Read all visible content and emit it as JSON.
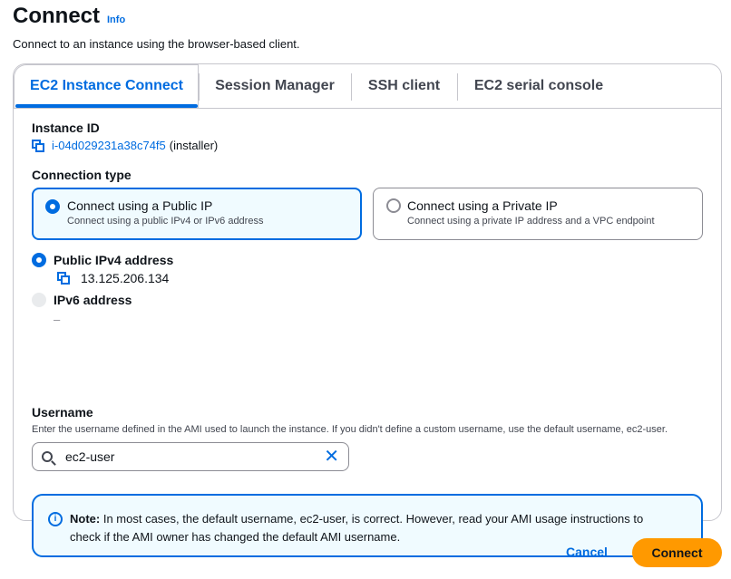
{
  "header": {
    "title": "Connect",
    "info_label": "Info",
    "description": "Connect to an instance using the browser-based client."
  },
  "tabs": [
    {
      "label": "EC2 Instance Connect",
      "active": true
    },
    {
      "label": "Session Manager",
      "active": false
    },
    {
      "label": "SSH client",
      "active": false
    },
    {
      "label": "EC2 serial console",
      "active": false
    }
  ],
  "instance": {
    "label": "Instance ID",
    "id": "i-04d029231a38c74f5",
    "suffix": "(installer)"
  },
  "connection_type": {
    "label": "Connection type",
    "options": [
      {
        "title": "Connect using a Public IP",
        "description": "Connect using a public IPv4 or IPv6 address",
        "selected": true
      },
      {
        "title": "Connect using a Private IP",
        "description": "Connect using a private IP address and a VPC endpoint",
        "selected": false
      }
    ]
  },
  "address": {
    "ipv4_label": "Public IPv4 address",
    "ipv4_value": "13.125.206.134",
    "ipv6_label": "IPv6 address",
    "ipv6_value": "–"
  },
  "username": {
    "label": "Username",
    "help": "Enter the username defined in the AMI used to launch the instance. If you didn't define a custom username, use the default username, ec2-user.",
    "value": "ec2-user"
  },
  "alert": {
    "bold": "Note:",
    "text": " In most cases, the default username, ec2-user, is correct. However, read your AMI usage instructions to check if the AMI owner has changed the default AMI username."
  },
  "footer": {
    "cancel_label": "Cancel",
    "connect_label": "Connect"
  },
  "colors": {
    "accent": "#006ce0",
    "primary_button": "#ff9900",
    "selected_tile_bg": "#f0fbff"
  }
}
